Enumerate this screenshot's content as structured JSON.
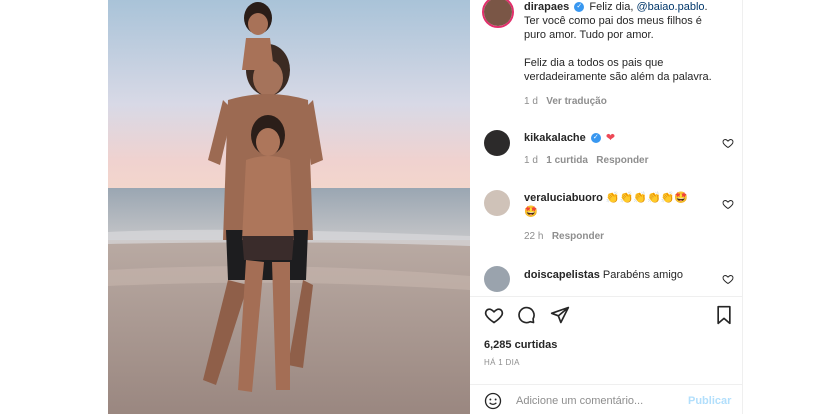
{
  "post": {
    "username": "dirapaes",
    "caption_line1_tail": "Feliz dia, ",
    "mention": "@baiao.pablo",
    "caption_line1_end": ".",
    "caption_line2": "Ter você como pai dos meus filhos é",
    "caption_line3": "puro amor. Tudo por amor.",
    "caption_line4": "Feliz dia a todos os pais que",
    "caption_line5": "verdadeiramente são além da palavra.",
    "time": "1 d",
    "translate": "Ver tradução"
  },
  "comments": [
    {
      "username": "kikakalache",
      "text": "❤",
      "time": "1 d",
      "likes": "1 curtida",
      "reply": "Responder"
    },
    {
      "username": "veralucia­buoro",
      "text": "👏👏👏👏👏🤩",
      "text2": "🤩",
      "time": "22 h",
      "reply": "Responder"
    },
    {
      "username": "doiscapelistas",
      "text": "Parabéns amigo"
    }
  ],
  "stats": {
    "likes": "6,285 curtidas",
    "ago": "HÁ 1 DIA"
  },
  "composer": {
    "placeholder": "Adicione um comentário...",
    "publish": "Publicar"
  },
  "colors": {
    "accent": "#3897f0",
    "heart": "#ed4956",
    "muted": "#8e8e8e"
  }
}
